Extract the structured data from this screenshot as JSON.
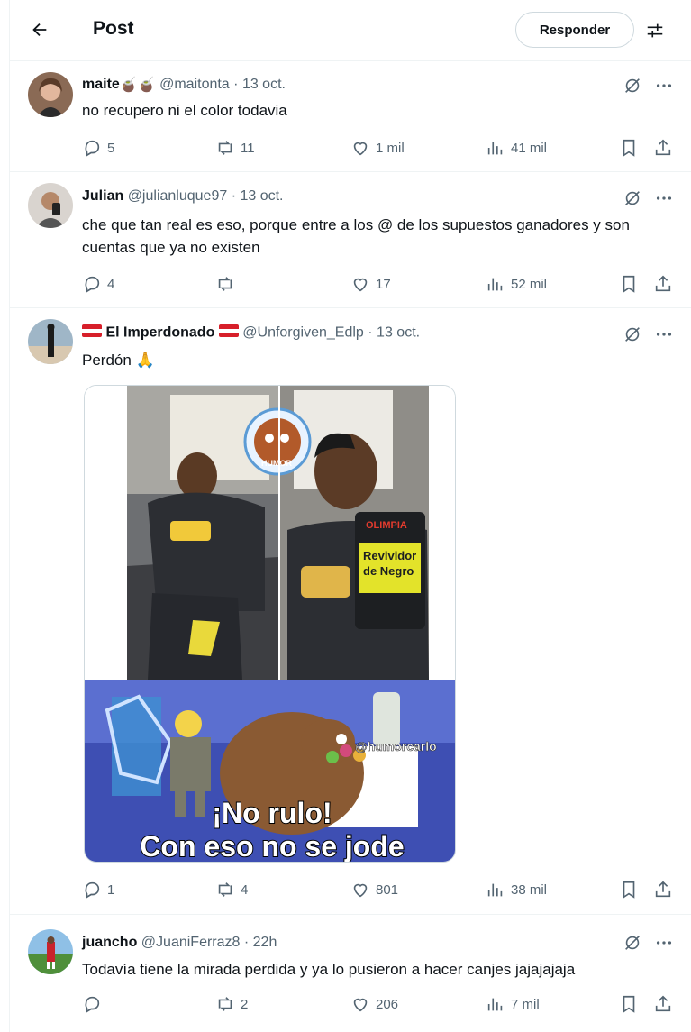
{
  "header": {
    "title": "Post",
    "reply_label": "Responder"
  },
  "tweets": [
    {
      "name": "maite",
      "name_emoji": "🧉🧉",
      "handle": "@maitonta",
      "dot": "·",
      "time": "13 oct.",
      "text": "no recupero ni el color todavia",
      "replies": "5",
      "retweets": "11",
      "likes": "1 mil",
      "views": "41 mil"
    },
    {
      "name": "Julian",
      "handle": "@julianluque97",
      "dot": "·",
      "time": "13 oct.",
      "text": "che que tan real es eso, porque entre a los @ de los supuestos ganadores y son cuentas que ya no existen",
      "replies": "4",
      "retweets": "",
      "likes": "17",
      "views": "52 mil"
    },
    {
      "name": "El Imperdonado",
      "handle": "@Unforgiven_Edlp",
      "dot": "·",
      "time": "13 oct.",
      "text": "Perdón",
      "text_emoji": "🙏",
      "meme": {
        "watermark_top": "HUMOR",
        "product_brand": "OLIMPIA",
        "product_line1": "Revividor",
        "product_line2": "de Negro",
        "watermark": "@humorcarlo",
        "caption_line1": "¡No rulo!",
        "caption_line2": "Con eso no se jode"
      },
      "replies": "1",
      "retweets": "4",
      "likes": "801",
      "views": "38 mil"
    },
    {
      "name": "juancho",
      "handle": "@JuaniFerraz8",
      "dot": "·",
      "time": "22h",
      "text": "Todavía tiene la mirada perdida y ya lo pusieron a hacer canjes jajajajaja",
      "replies": "",
      "retweets": "2",
      "likes": "206",
      "views": "7 mil"
    }
  ],
  "icons": [
    "back-arrow-icon",
    "filter-icon",
    "grok-icon",
    "more-icon",
    "reply-icon",
    "retweet-icon",
    "like-icon",
    "views-icon",
    "bookmark-icon",
    "share-icon"
  ],
  "colors": {
    "text": "#0f1419",
    "secondary": "#536471",
    "border": "#eff3f4"
  }
}
